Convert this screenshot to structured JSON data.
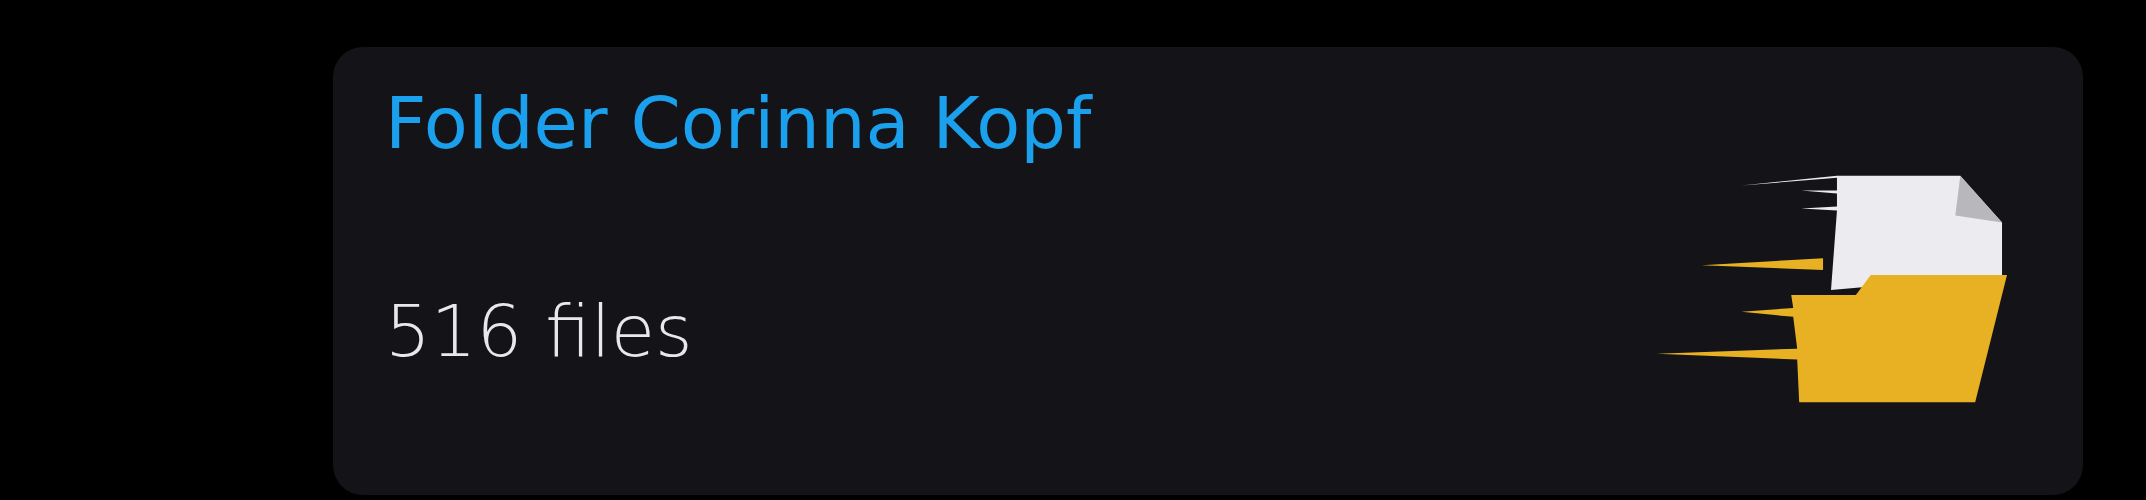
{
  "folder_card": {
    "title": "Folder Corinna Kopf",
    "file_count": "516 files"
  }
}
